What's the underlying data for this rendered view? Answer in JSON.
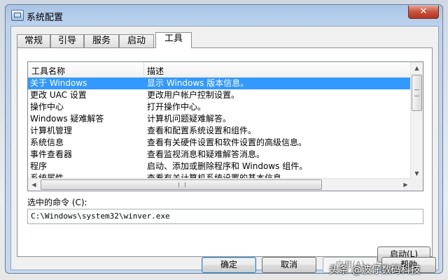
{
  "window": {
    "title": "系统配置",
    "close_symbol": "✕"
  },
  "tabs": [
    "常规",
    "引导",
    "服务",
    "启动",
    "工具"
  ],
  "list": {
    "headers": [
      "工具名称",
      "描述"
    ],
    "rows": [
      {
        "name": "关于 Windows",
        "desc": "显示 Windows 版本信息。"
      },
      {
        "name": "更改 UAC 设置",
        "desc": "更改用户帐户控制设置。"
      },
      {
        "name": "操作中心",
        "desc": "打开操作中心。"
      },
      {
        "name": "Windows 疑难解答",
        "desc": "计算机问题疑难解答。"
      },
      {
        "name": "计算机管理",
        "desc": "查看和配置系统设置和组件。"
      },
      {
        "name": "系统信息",
        "desc": "查看有关硬件设置和软件设置的高级信息。"
      },
      {
        "name": "事件查看器",
        "desc": "查看监视消息和疑难解答消息。"
      },
      {
        "name": "程序",
        "desc": "启动、添加或删除程序和 Windows 组件。"
      },
      {
        "name": "系统属性",
        "desc": "查看有关计算机系统设置的基本信息。"
      }
    ],
    "selected_index": 0
  },
  "command": {
    "label": "选中的命令 (C):",
    "value": "C:\\Windows\\system32\\winver.exe"
  },
  "buttons": {
    "launch": "启动(L)",
    "ok": "确定",
    "cancel": "取消",
    "apply": "应用(A)",
    "help": "帮助"
  },
  "watermark": "头条 @波仔数码科技",
  "icons": {
    "app": "system-config-icon",
    "close": "close-icon"
  },
  "colors": {
    "selection": "#3399ff",
    "close_button": "#c9513c"
  }
}
